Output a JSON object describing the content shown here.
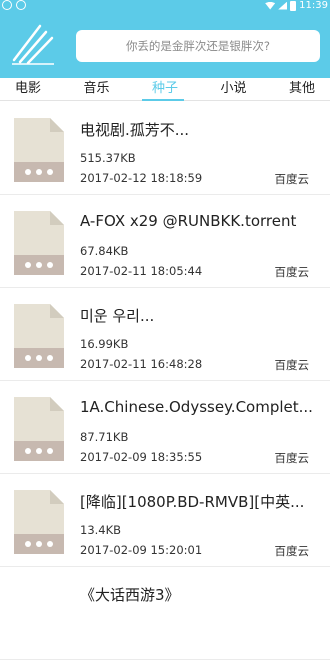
{
  "status": {
    "time": "11:39"
  },
  "search": {
    "placeholder": "你丢的是金胖次还是银胖次?"
  },
  "tabs": [
    {
      "label": "电影",
      "active": false
    },
    {
      "label": "音乐",
      "active": false
    },
    {
      "label": "种子",
      "active": true
    },
    {
      "label": "小说",
      "active": false
    },
    {
      "label": "其他",
      "active": false
    }
  ],
  "colors": {
    "accent": "#5ccbe8",
    "icon_body": "#e6e1d4",
    "icon_band": "#c7b9b0"
  },
  "files": [
    {
      "name": "电视剧.孤芳不...",
      "size": "515.37KB",
      "date": "2017-02-12 18:18:59",
      "source": "百度云"
    },
    {
      "name": "A-FOX x29 @RUNBKK.torrent",
      "size": "67.84KB",
      "date": "2017-02-11 18:05:44",
      "source": "百度云"
    },
    {
      "name": "미운 우리...",
      "size": "16.99KB",
      "date": "2017-02-11 16:48:28",
      "source": "百度云"
    },
    {
      "name": "1A.Chinese.Odyssey.Complet...",
      "size": "87.71KB",
      "date": "2017-02-09 18:35:55",
      "source": "百度云"
    },
    {
      "name": "[降临][1080P.BD-RMVB][中英...",
      "size": "13.4KB",
      "date": "2017-02-09 15:20:01",
      "source": "百度云"
    },
    {
      "name": "《大话西游3》",
      "size": "",
      "date": "",
      "source": ""
    }
  ]
}
